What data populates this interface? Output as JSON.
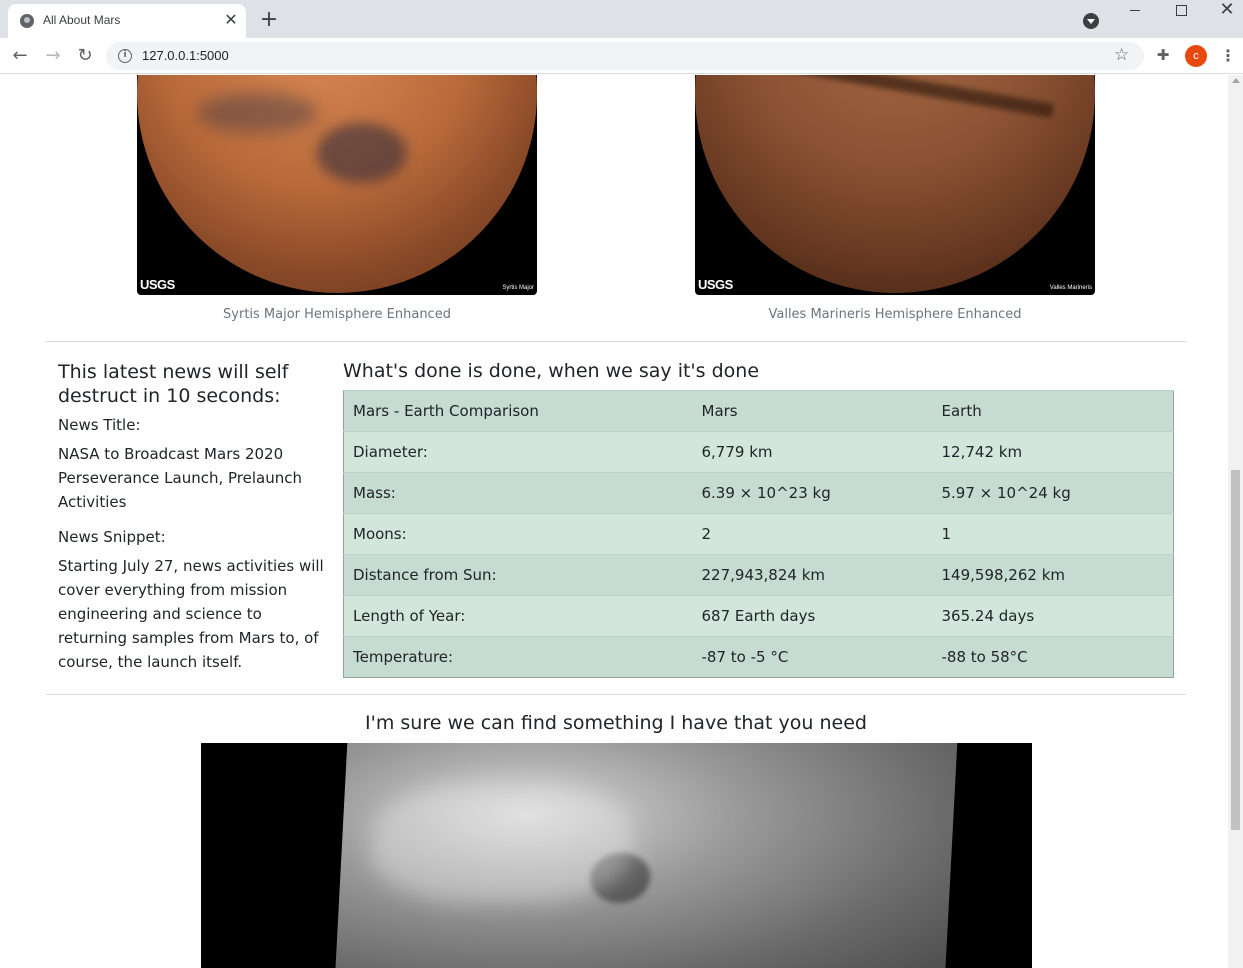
{
  "browser": {
    "tab_title": "All About Mars",
    "url": "127.0.0.1:5000",
    "profile_initial": "c"
  },
  "hemispheres": [
    {
      "caption": "Syrtis Major Hemisphere Enhanced",
      "image_tag": "Syrtis Major",
      "logo": "USGS"
    },
    {
      "caption": "Valles Marineris Hemisphere Enhanced",
      "image_tag": "Valles Marineris",
      "logo": "USGS"
    }
  ],
  "news": {
    "heading": "This latest news will self destruct in 10 seconds:",
    "title_label": "News Title:",
    "title": "NASA to Broadcast Mars 2020 Perseverance Launch, Prelaunch Activities",
    "snippet_label": "News Snippet:",
    "snippet": "Starting July 27, news activities will cover everything from mission engineering and science to returning samples from Mars to, of course, the launch itself."
  },
  "facts": {
    "heading": "What's done is done, when we say it's done",
    "rows": [
      [
        "Mars - Earth Comparison",
        "Mars",
        "Earth"
      ],
      [
        "Diameter:",
        "6,779 km",
        "12,742 km"
      ],
      [
        "Mass:",
        "6.39 × 10^23 kg",
        "5.97 × 10^24 kg"
      ],
      [
        "Moons:",
        "2",
        "1"
      ],
      [
        "Distance from Sun:",
        "227,943,824 km",
        "149,598,262 km"
      ],
      [
        "Length of Year:",
        "687 Earth days",
        "365.24 days"
      ],
      [
        "Temperature:",
        "-87 to -5 °C",
        "-88 to 58°C"
      ]
    ]
  },
  "featured": {
    "heading": "I'm sure we can find something I have that you need"
  },
  "colors": {
    "table_odd": "#c6dbd2",
    "table_even": "#d2e6dc",
    "avatar": "#e8490f"
  }
}
